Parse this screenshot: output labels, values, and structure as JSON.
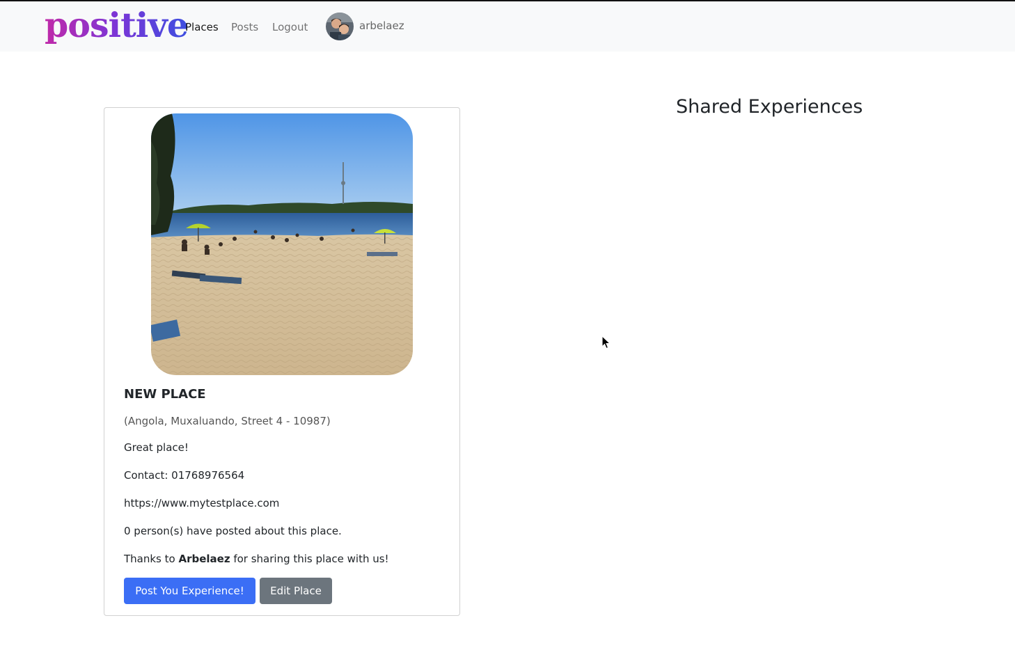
{
  "navbar": {
    "brand": "positive",
    "links": [
      {
        "label": "Places",
        "active": true
      },
      {
        "label": "Posts",
        "active": false
      },
      {
        "label": "Logout",
        "active": false
      }
    ],
    "username": "arbelaez"
  },
  "place": {
    "title": "NEW PLACE",
    "address": "(Angola, Muxaluando, Street 4 - 10987)",
    "description": "Great place!",
    "contact": "Contact: 01768976564",
    "website": "https://www.mytestplace.com",
    "post_count_text": "0 person(s) have posted about this place.",
    "thanks_prefix": "Thanks to ",
    "thanks_user": "Arbelaez",
    "thanks_suffix": " for sharing this place with us!",
    "post_button": "Post You Experience!",
    "edit_button": "Edit Place"
  },
  "shared": {
    "title": "Shared Experiences"
  },
  "colors": {
    "primary": "#3b6ef5",
    "secondary": "#6c757d",
    "navbar_bg": "#f8f9fa"
  }
}
